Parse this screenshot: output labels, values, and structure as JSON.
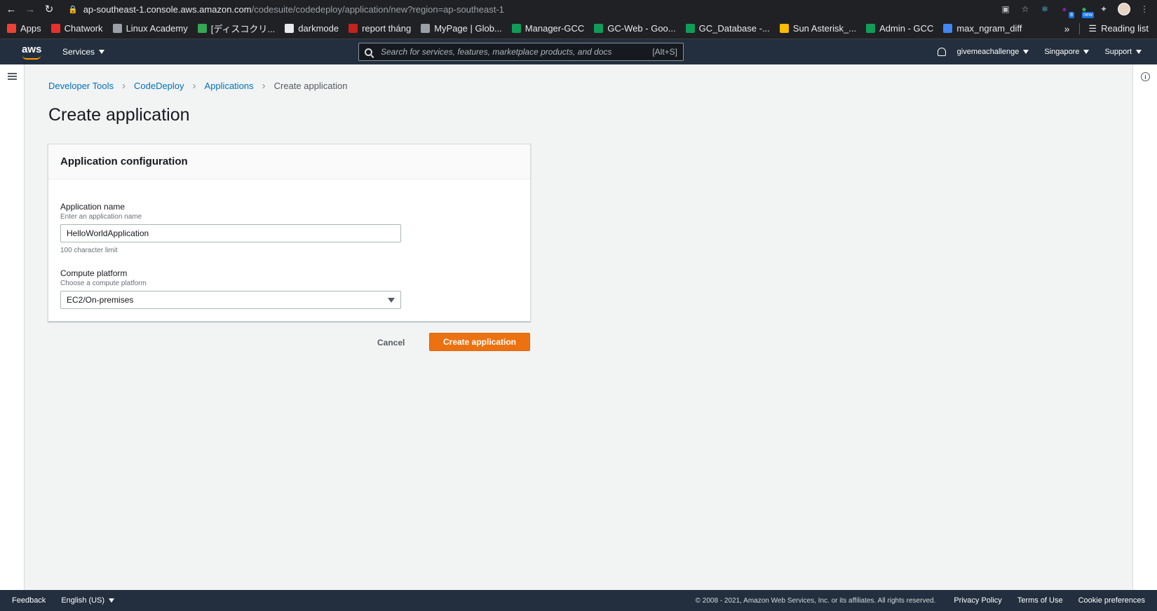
{
  "browser": {
    "url_host": "ap-southeast-1.console.aws.amazon.com",
    "url_path": "/codesuite/codedeploy/application/new?region=ap-southeast-1",
    "ext_badge_count": "8",
    "ext_badge_new": "new"
  },
  "bookmarks": [
    {
      "label": "Apps",
      "color": "#ea4335"
    },
    {
      "label": "Chatwork",
      "color": "#e8312e"
    },
    {
      "label": "Linux Academy",
      "color": "#9aa0a6"
    },
    {
      "label": "[ディスコクリ...",
      "color": "#34a853"
    },
    {
      "label": "darkmode",
      "color": "#e8eaed"
    },
    {
      "label": "report tháng",
      "color": "#c5221f"
    },
    {
      "label": "MyPage | Glob...",
      "color": "#9aa0a6"
    },
    {
      "label": "Manager-GCC",
      "color": "#0f9d58"
    },
    {
      "label": "GC-Web - Goo...",
      "color": "#0f9d58"
    },
    {
      "label": "GC_Database -...",
      "color": "#0f9d58"
    },
    {
      "label": "Sun Asterisk_...",
      "color": "#fbbc04"
    },
    {
      "label": "Admin - GCC",
      "color": "#0f9d58"
    },
    {
      "label": "max_ngram_diff",
      "color": "#4285f4"
    }
  ],
  "bookmarks_more": "»",
  "reading_list": "Reading list",
  "aws_nav": {
    "logo": "aws",
    "services": "Services",
    "search_placeholder": "Search for services, features, marketplace products, and docs",
    "search_shortcut": "[Alt+S]",
    "account": "givemeachallenge",
    "region": "Singapore",
    "support": "Support"
  },
  "breadcrumb": {
    "items": [
      "Developer Tools",
      "CodeDeploy",
      "Applications"
    ],
    "current": "Create application"
  },
  "page_title": "Create application",
  "panel": {
    "header": "Application configuration",
    "app_name_label": "Application name",
    "app_name_desc": "Enter an application name",
    "app_name_value": "HelloWorldApplication",
    "app_name_constraint": "100 character limit",
    "platform_label": "Compute platform",
    "platform_desc": "Choose a compute platform",
    "platform_value": "EC2/On-premises"
  },
  "actions": {
    "cancel": "Cancel",
    "create": "Create application"
  },
  "footer": {
    "feedback": "Feedback",
    "language": "English (US)",
    "copyright": "© 2008 - 2021, Amazon Web Services, Inc. or its affiliates. All rights reserved.",
    "privacy": "Privacy Policy",
    "terms": "Terms of Use",
    "cookies": "Cookie preferences"
  },
  "colors": {
    "accent": "#ec7211",
    "link": "#0073bb",
    "nav_bg": "#232f3e"
  }
}
